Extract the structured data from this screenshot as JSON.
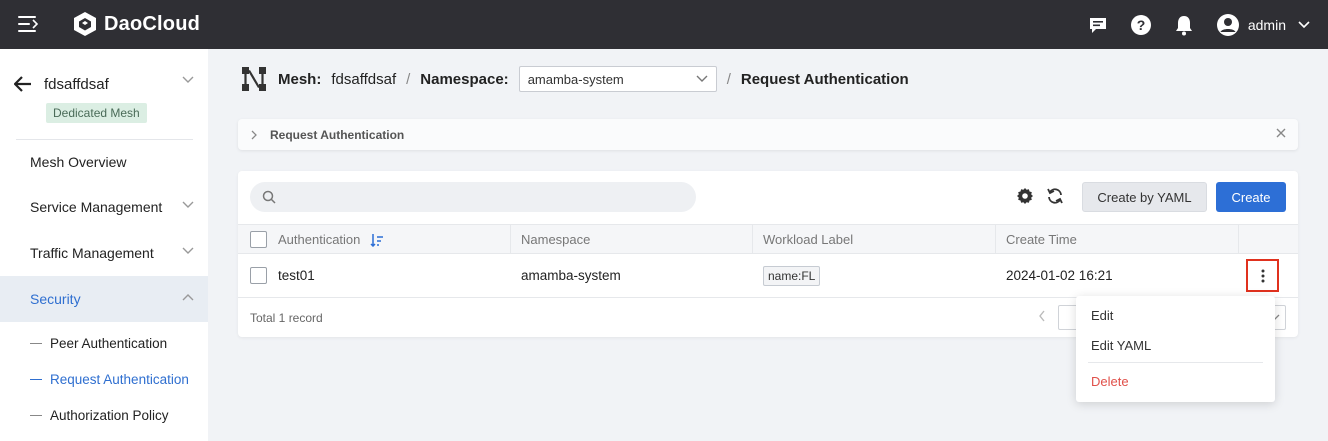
{
  "app": {
    "name": "DaoCloud"
  },
  "topbar": {
    "user_name": "admin"
  },
  "sidebar": {
    "mesh_name": "fdsaffdsaf",
    "mesh_badge": "Dedicated Mesh",
    "items": [
      {
        "label": "Mesh Overview"
      },
      {
        "label": "Service Management"
      },
      {
        "label": "Traffic Management"
      },
      {
        "label": "Security"
      }
    ],
    "security_sub": [
      {
        "label": "Peer Authentication"
      },
      {
        "label": "Request Authentication"
      },
      {
        "label": "Authorization Policy"
      }
    ]
  },
  "breadcrumb": {
    "mesh_label": "Mesh:",
    "mesh_value": "fdsaffdsaf",
    "namespace_label": "Namespace:",
    "namespace_value": "amamba-system",
    "page": "Request Authentication"
  },
  "infobar": {
    "text": "Request Authentication"
  },
  "toolbar": {
    "search_placeholder": "",
    "create_yaml_label": "Create by YAML",
    "create_label": "Create"
  },
  "table": {
    "columns": [
      "Authentication",
      "Namespace",
      "Workload Label",
      "Create Time"
    ],
    "rows": [
      {
        "name": "test01",
        "namespace": "amamba-system",
        "label": "name:FL",
        "create_time": "2024-01-02 16:21"
      }
    ],
    "footer": "Total 1 record"
  },
  "menu": {
    "items": [
      {
        "label": "Edit"
      },
      {
        "label": "Edit YAML"
      },
      {
        "label": "Delete"
      }
    ]
  },
  "colors": {
    "accent": "#2d6fd6",
    "topbar": "#2f2f34",
    "danger": "#e0504a",
    "highlight": "#e0311e"
  }
}
